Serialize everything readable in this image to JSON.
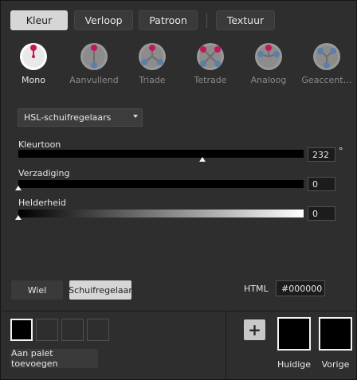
{
  "tabs": [
    {
      "label": "Kleur",
      "active": true
    },
    {
      "label": "Verloop",
      "active": false
    },
    {
      "label": "Patroon",
      "active": false
    },
    {
      "label": "Textuur",
      "active": false
    }
  ],
  "modes": [
    {
      "label": "Mono",
      "icon": "mono-harmony-icon",
      "active": true
    },
    {
      "label": "Aanvullend",
      "icon": "complementary-harmony-icon",
      "active": false
    },
    {
      "label": "Triade",
      "icon": "triad-harmony-icon",
      "active": false
    },
    {
      "label": "Tetrade",
      "icon": "tetrad-harmony-icon",
      "active": false
    },
    {
      "label": "Analoog",
      "icon": "analogous-harmony-icon",
      "active": false
    },
    {
      "label": "Geaccent…",
      "icon": "accented-harmony-icon",
      "active": false
    }
  ],
  "slider_mode": {
    "selected": "HSL-schuifregelaars"
  },
  "sliders": {
    "hue": {
      "label": "Kleurtoon",
      "value": "232",
      "unit": "°",
      "fraction": 0.644
    },
    "saturation": {
      "label": "Verzadiging",
      "value": "0",
      "fraction": 0.0
    },
    "brightness": {
      "label": "Helderheid",
      "value": "0",
      "fraction": 0.0
    }
  },
  "picker_buttons": {
    "wheel": "Wiel",
    "sliders": "Schuifregelaar"
  },
  "html": {
    "label": "HTML",
    "value": "#000000"
  },
  "palette": {
    "add_label": "Aan palet toevoegen"
  },
  "current": {
    "label": "Huidige"
  },
  "previous": {
    "label": "Vorige"
  },
  "colors": {
    "accent_pink": "#c2185b",
    "accent_blue": "#5b7fa8",
    "active_tab": "#d6d6d6",
    "panel_bg": "#2e2e2e"
  }
}
